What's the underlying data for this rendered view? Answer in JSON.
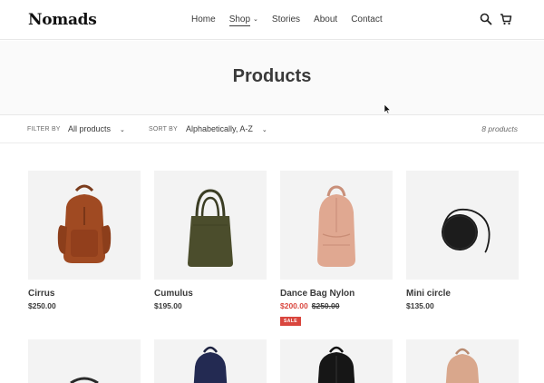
{
  "header": {
    "logo": "Nomads",
    "nav": [
      {
        "label": "Home"
      },
      {
        "label": "Shop",
        "caret": "⌄"
      },
      {
        "label": "Stories"
      },
      {
        "label": "About"
      },
      {
        "label": "Contact"
      }
    ],
    "icons": [
      "search-icon",
      "cart-icon"
    ]
  },
  "collection": {
    "title": "Products"
  },
  "filter_bar": {
    "filter_label": "FILTER BY",
    "filter_value": "All products",
    "sort_label": "SORT BY",
    "sort_value": "Alphabetically, A-Z",
    "caret": "⌄",
    "count": "8 products"
  },
  "products": [
    {
      "name": "Cirrus",
      "price": "$250.00",
      "icon": "brown-backpack-image"
    },
    {
      "name": "Cumulus",
      "price": "$195.00",
      "icon": "olive-tote-bag-image"
    },
    {
      "name": "Dance Bag Nylon",
      "sale_price": "$200.00",
      "compare_price": "$250.00",
      "badge": "SALE",
      "icon": "pink-backpack-image"
    },
    {
      "name": "Mini circle",
      "price": "$135.00",
      "icon": "black-circle-bag-image"
    }
  ],
  "colors": {
    "sale": "#d9463e",
    "text": "#3a3a3a",
    "image_bg": "#f3f3f3"
  }
}
